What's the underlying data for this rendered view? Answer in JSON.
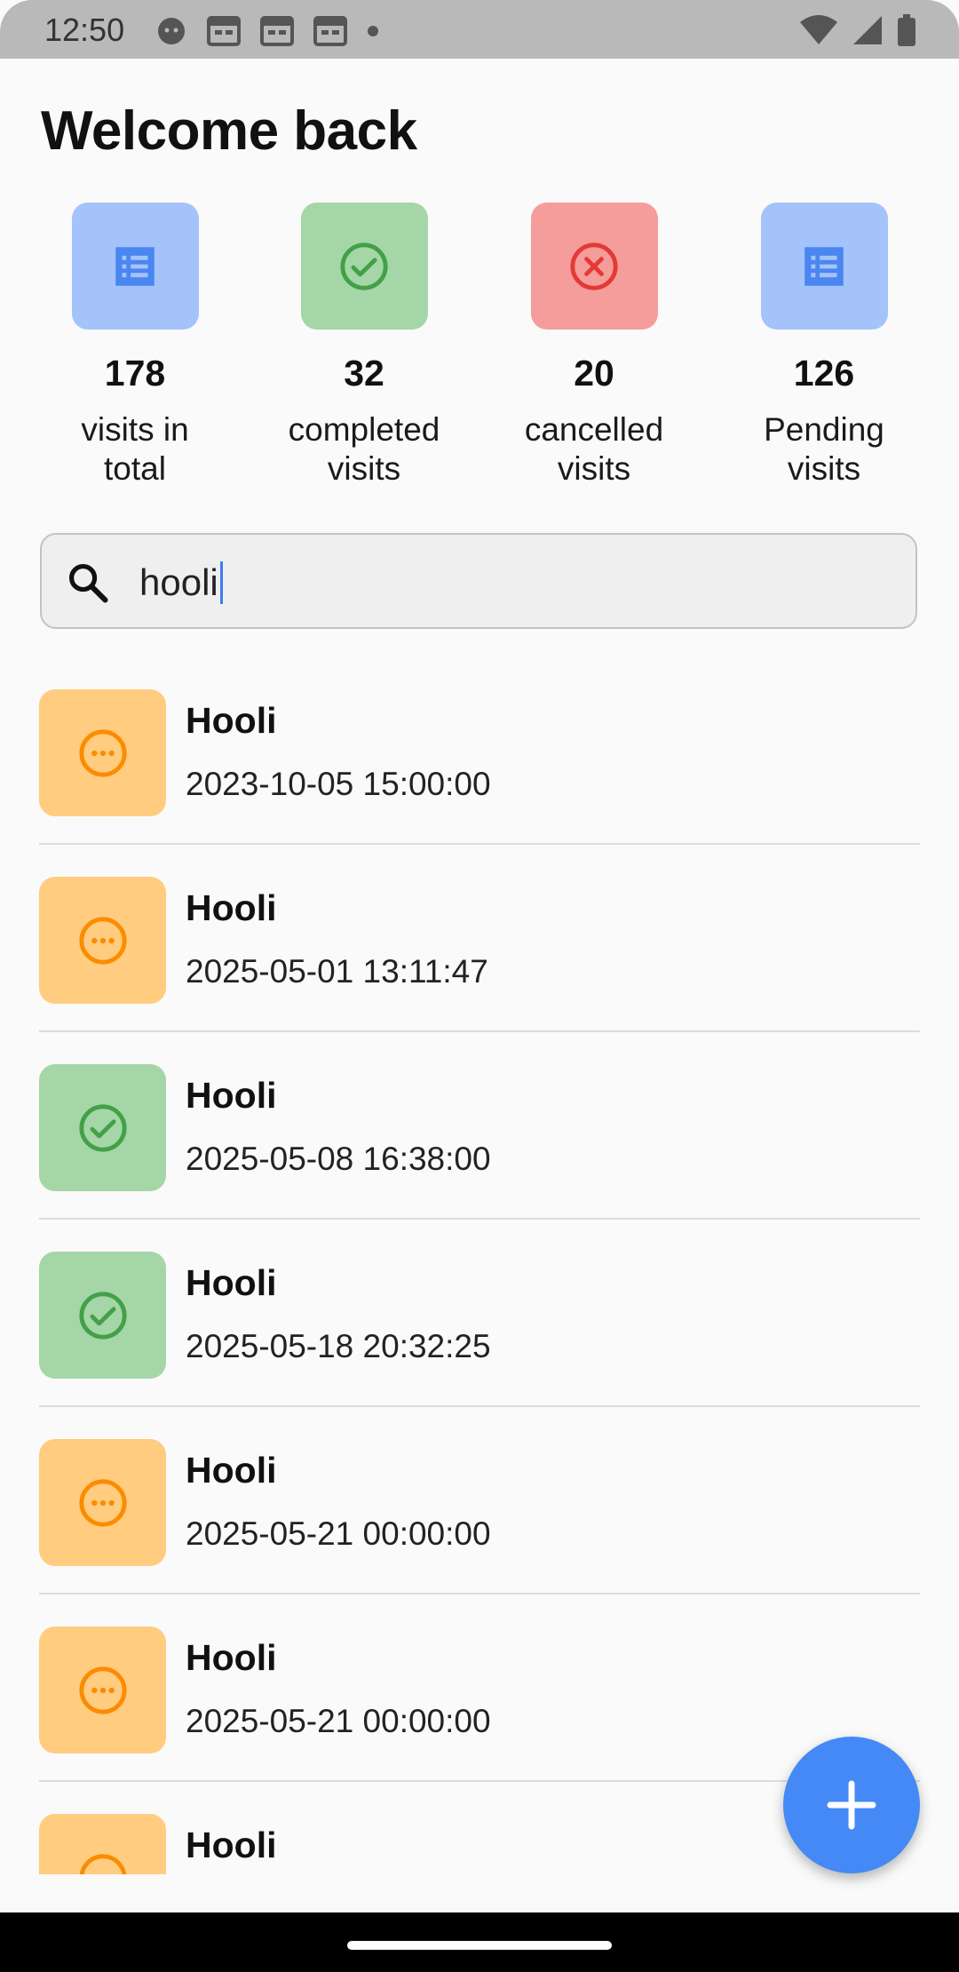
{
  "status_bar": {
    "time": "12:50"
  },
  "header": {
    "title": "Welcome back"
  },
  "stats": [
    {
      "value": "178",
      "label_line1": "visits in",
      "label_line2": "total",
      "icon": "list-icon",
      "bg": "#a5c3fb",
      "fg": "#4a86f0"
    },
    {
      "value": "32",
      "label_line1": "completed",
      "label_line2": "visits",
      "icon": "check-circle-icon",
      "bg": "#a5d6a7",
      "fg": "#43a047"
    },
    {
      "value": "20",
      "label_line1": "cancelled",
      "label_line2": "visits",
      "icon": "cancel-circle-icon",
      "bg": "#f59d9a",
      "fg": "#e53935"
    },
    {
      "value": "126",
      "label_line1": "Pending",
      "label_line2": "visits",
      "icon": "list-icon",
      "bg": "#a5c3fb",
      "fg": "#4a86f0"
    }
  ],
  "search": {
    "value": "hooli",
    "icon": "search-icon"
  },
  "visits": [
    {
      "title": "Hooli",
      "datetime": "2023-10-05 15:00:00",
      "status": "pending"
    },
    {
      "title": "Hooli",
      "datetime": "2025-05-01 13:11:47",
      "status": "pending"
    },
    {
      "title": "Hooli",
      "datetime": "2025-05-08 16:38:00",
      "status": "completed"
    },
    {
      "title": "Hooli",
      "datetime": "2025-05-18 20:32:25",
      "status": "completed"
    },
    {
      "title": "Hooli",
      "datetime": "2025-05-21 00:00:00",
      "status": "pending"
    },
    {
      "title": "Hooli",
      "datetime": "2025-05-21 00:00:00",
      "status": "pending"
    },
    {
      "title": "Hooli",
      "datetime": "",
      "status": "pending"
    }
  ],
  "status_styles": {
    "pending": {
      "bg": "#ffcc80",
      "fg": "#fb8c00",
      "icon": "more-horiz-circle-icon"
    },
    "completed": {
      "bg": "#a5d6a7",
      "fg": "#43a047",
      "icon": "check-circle-icon"
    }
  },
  "fab": {
    "icon": "plus-icon",
    "color": "#4489f5"
  }
}
